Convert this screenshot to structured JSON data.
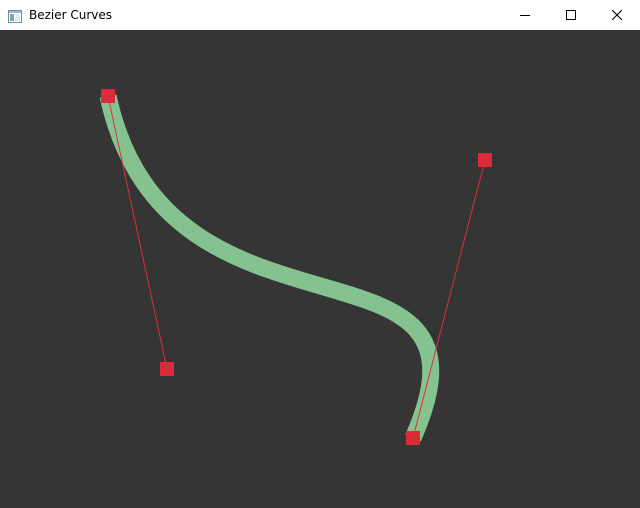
{
  "window": {
    "title": "Bezier Curves",
    "icons": {
      "app": "app-window-icon",
      "minimize": "minimize-icon",
      "maximize": "maximize-icon",
      "close": "close-icon"
    }
  },
  "colors": {
    "canvas_background": "#353535",
    "curve": "#84c38f",
    "handle_line": "#e02f3c",
    "control_point": "#dc2a38",
    "titlebar": "#ffffff"
  },
  "curve": {
    "type": "cubic-bezier",
    "points_count": 4
  }
}
